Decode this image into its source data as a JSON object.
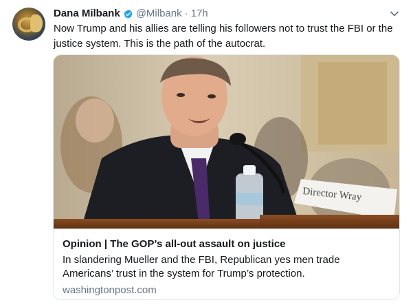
{
  "tweet": {
    "author_name": "Dana Milbank",
    "handle": "@Milbank",
    "separator": "·",
    "time": "17h",
    "text_line1": "Now Trump and his allies are telling his followers not to trust the FBI or the",
    "text_line2": "justice system.  This is the path of the autocrat."
  },
  "card": {
    "placard_text": "Director Wray",
    "title": "Opinion | The GOP’s all-out assault on justice",
    "description": "In slandering Mueller and the FBI, Republican yes men trade Americans’ trust in the system for Trump’s protection.",
    "domain": "washingtonpost.com"
  },
  "colors": {
    "verified_blue": "#1da1f2",
    "secondary_text": "#657786",
    "border": "#e1e8ed"
  },
  "icons": {
    "verified": "verified-badge-icon",
    "caret": "chevron-down-icon"
  }
}
